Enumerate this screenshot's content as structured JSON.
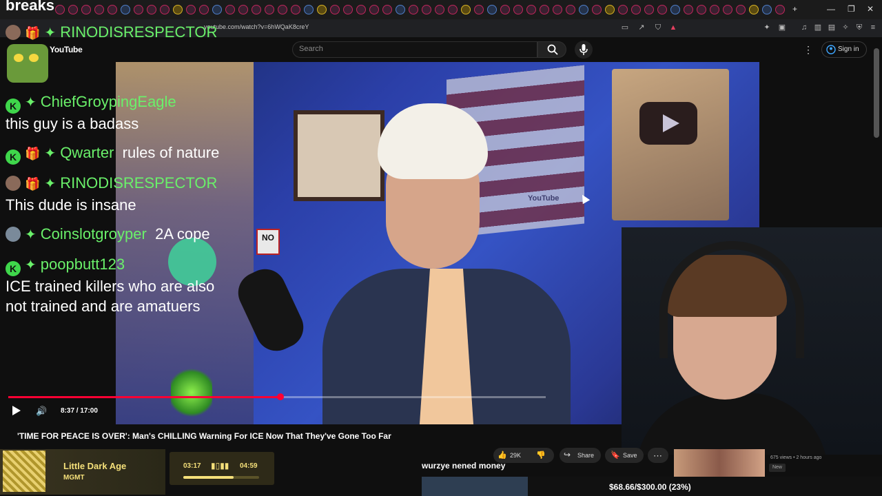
{
  "window": {
    "minimize": "—",
    "maximize": "❐",
    "close": "✕",
    "new_tab": "+"
  },
  "address": {
    "url": "youtube.com/watch?v=6hWQaK8creY"
  },
  "youtube": {
    "logo": "YouTube",
    "search_placeholder": "Search",
    "sign_in": "Sign in"
  },
  "stream_overlay": {
    "top_text": "breaks",
    "chat": [
      {
        "user": "RINODISRESPECTOR",
        "message": ""
      },
      {
        "user": "ChiefGroypingEagle",
        "message": "this guy is a badass"
      },
      {
        "user": "Qwarter",
        "message": "rules of nature"
      },
      {
        "user": "RINODISRESPECTOR",
        "message": "This dude is insane"
      },
      {
        "user": "Coinslotgroyper",
        "message": "2A cope"
      },
      {
        "user": "poopbutt123",
        "message": "ICE trained killers who are also"
      },
      {
        "user": "",
        "message": "not trained and are amatuers"
      }
    ],
    "caption": "wurzye nened money",
    "goal": {
      "text": "$68.66/$300.00 (23%)",
      "progress": 0.23
    }
  },
  "video_scene": {
    "sign_text": "NO",
    "plaque_text": "YouTube"
  },
  "player": {
    "time": "8:37 / 17:00",
    "progress": 0.507
  },
  "video": {
    "title": "'TIME FOR PEACE IS OVER': Man's CHILLING Warning For ICE Now That They've Gone Too Far",
    "likes": "29K",
    "share": "Share",
    "save": "Save"
  },
  "recommendation": {
    "meta": "675 views • 2 hours ago",
    "badge": "New"
  },
  "music": {
    "song": "Little Dark Age",
    "artist": "MGMT",
    "current": "03:17",
    "total": "04:59",
    "progress": 0.66
  }
}
